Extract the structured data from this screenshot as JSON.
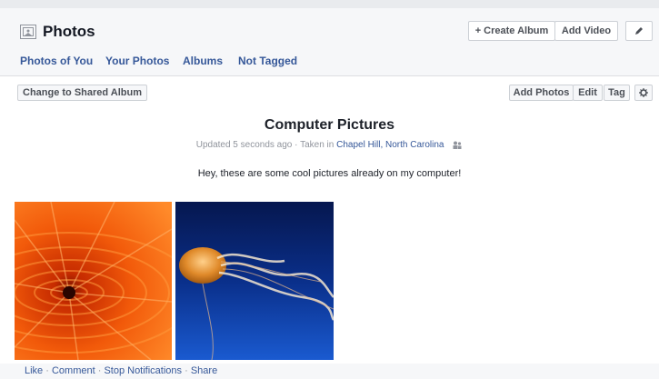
{
  "header": {
    "title": "Photos",
    "create_album_label": "+ Create Album",
    "add_video_label": "Add Video"
  },
  "tabs": [
    "Photos of You",
    "Your Photos",
    "Albums",
    "Not Tagged"
  ],
  "toolbar": {
    "shared_album_label": "Change to Shared Album",
    "add_photos_label": "Add Photos",
    "edit_label": "Edit",
    "tag_label": "Tag"
  },
  "album": {
    "title": "Computer Pictures",
    "updated": "Updated 5 seconds ago",
    "separator": " · ",
    "taken_in": "Taken in",
    "location": "Chapel Hill, North Carolina",
    "description": "Hey, these are some cool pictures already on my computer!"
  },
  "photos": [
    {
      "subject": "orange chrysanthemum"
    },
    {
      "subject": "jellyfish"
    }
  ],
  "footer": {
    "like": "Like",
    "comment": "Comment",
    "stop_notifications": "Stop Notifications",
    "share": "Share",
    "dot": " · "
  },
  "colors": {
    "link": "#365899",
    "header_bg": "#f6f7f9",
    "border": "#ccd0d5"
  }
}
